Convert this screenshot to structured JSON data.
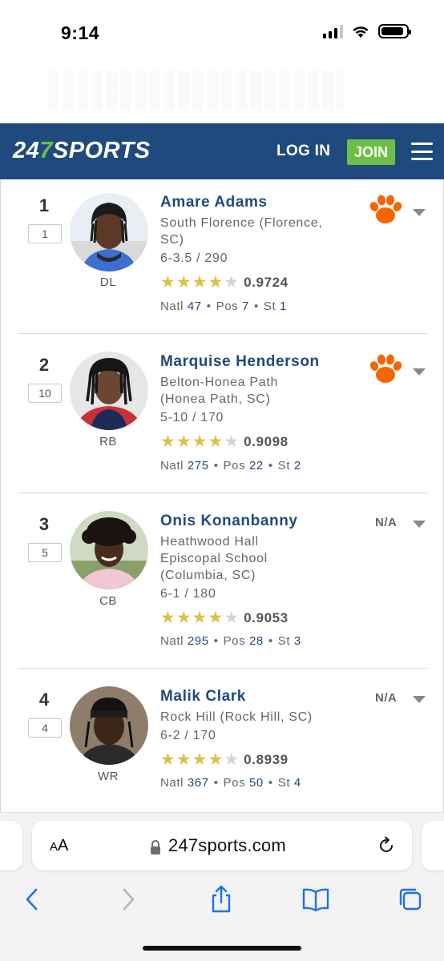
{
  "status_bar": {
    "time": "9:14"
  },
  "header": {
    "logo_prefix": "24",
    "logo_seven": "7",
    "logo_suffix": "SPORTS",
    "login_label": "LOG IN",
    "join_label": "JOIN",
    "menu_icon": "hamburger-menu-icon"
  },
  "players": [
    {
      "rank": "1",
      "prev_rank": "1",
      "name": "Amare Adams",
      "school_line1": "South Florence (Florence,",
      "school_line2": "SC)",
      "school_line3": "",
      "metrics": "6-3.5 / 290",
      "position": "DL",
      "stars": 4,
      "rating": "0.9724",
      "natl_label": "Natl",
      "natl": "47",
      "pos_label": "Pos",
      "pos": "7",
      "st_label": "St",
      "st": "1",
      "commit": "clemson-paw-logo"
    },
    {
      "rank": "2",
      "prev_rank": "10",
      "name": "Marquise Henderson",
      "school_line1": "Belton-Honea Path",
      "school_line2": "(Honea Path, SC)",
      "school_line3": "",
      "metrics": "5-10 / 170",
      "position": "RB",
      "stars": 4,
      "rating": "0.9098",
      "natl_label": "Natl",
      "natl": "275",
      "pos_label": "Pos",
      "pos": "22",
      "st_label": "St",
      "st": "2",
      "commit": "clemson-paw-logo"
    },
    {
      "rank": "3",
      "prev_rank": "5",
      "name": "Onis Konanbanny",
      "school_line1": "Heathwood Hall",
      "school_line2": "Episcopal School",
      "school_line3": "(Columbia, SC)",
      "metrics": "6-1 / 180",
      "position": "CB",
      "stars": 4,
      "rating": "0.9053",
      "natl_label": "Natl",
      "natl": "295",
      "pos_label": "Pos",
      "pos": "28",
      "st_label": "St",
      "st": "3",
      "commit_text": "N/A"
    },
    {
      "rank": "4",
      "prev_rank": "4",
      "name": "Malik Clark",
      "school_line1": "Rock Hill (Rock Hill, SC)",
      "school_line2": "",
      "school_line3": "",
      "metrics": "6-2 / 170",
      "position": "WR",
      "stars": 4,
      "rating": "0.8939",
      "natl_label": "Natl",
      "natl": "367",
      "pos_label": "Pos",
      "pos": "50",
      "st_label": "St",
      "st": "4",
      "commit_text": "N/A"
    }
  ],
  "browser": {
    "aa_small": "A",
    "aa_large": "A",
    "url": "247sports.com"
  },
  "colors": {
    "header_bg": "#1f4a7e",
    "join_bg": "#6dbe46",
    "star": "#d7c541",
    "clemson_orange": "#f56600",
    "ios_blue": "#1a73e8"
  }
}
